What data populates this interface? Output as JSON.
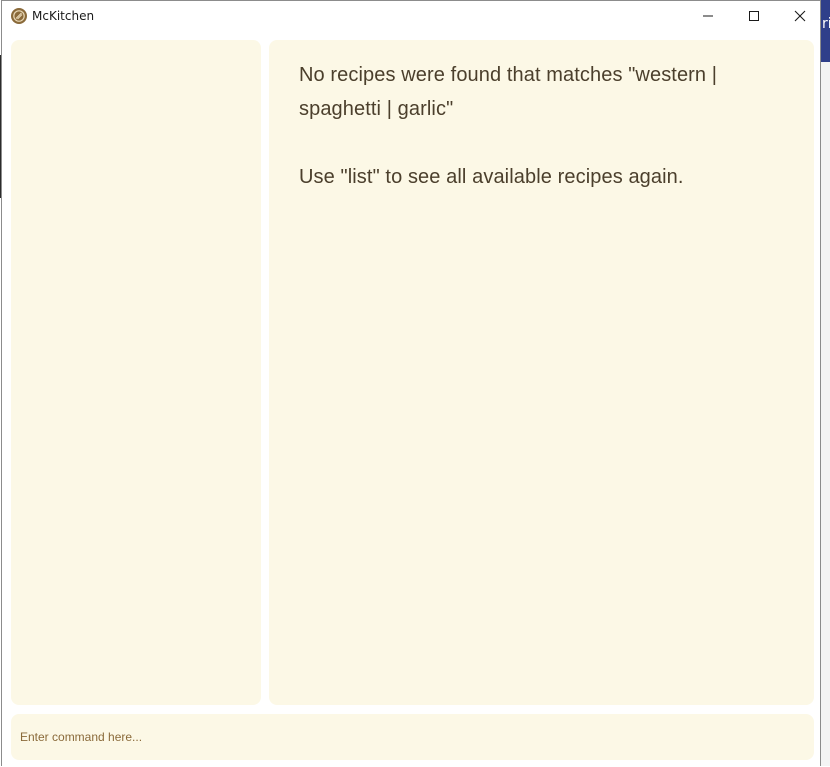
{
  "window": {
    "title": "McKitchen"
  },
  "result": {
    "message": "No recipes were found that matches \"western |\nspaghetti | garlic\"\n\nUse \"list\" to see all available recipes again."
  },
  "command": {
    "placeholder": "Enter command here...",
    "value": ""
  },
  "colors": {
    "panel_bg": "#fcf8e6",
    "text": "#4b3f2c",
    "icon_brown": "#8a6a3a"
  }
}
